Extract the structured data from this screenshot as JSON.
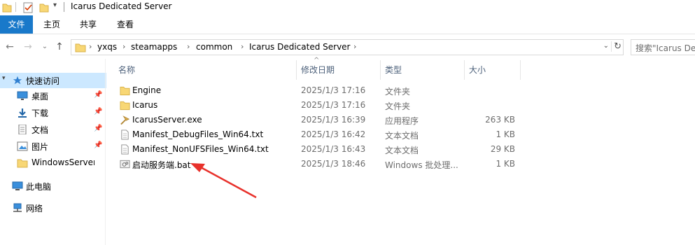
{
  "window": {
    "title": "Icarus Dedicated Server"
  },
  "ribbon": {
    "tabs": [
      "文件",
      "主页",
      "共享",
      "查看"
    ]
  },
  "address": {
    "crumbs": [
      "yxqs",
      "steamapps",
      "common",
      "Icarus Dedicated Server"
    ],
    "search_placeholder": "搜索\"Icarus Dedi"
  },
  "sidebar": {
    "quick_access": "快速访问",
    "items": [
      {
        "label": "桌面",
        "icon": "desktop-icon",
        "pinned": true
      },
      {
        "label": "下载",
        "icon": "download-icon",
        "pinned": true
      },
      {
        "label": "文档",
        "icon": "document-icon",
        "pinned": true
      },
      {
        "label": "图片",
        "icon": "picture-icon",
        "pinned": true
      },
      {
        "label": "WindowsServer",
        "icon": "folder-icon",
        "pinned": false
      }
    ],
    "this_pc": "此电脑",
    "network": "网络"
  },
  "columns": {
    "name": "名称",
    "date": "修改日期",
    "type": "类型",
    "size": "大小"
  },
  "files": [
    {
      "name": "Engine",
      "date": "2025/1/3 17:16",
      "type": "文件夹",
      "size": "",
      "icon": "folder-icon"
    },
    {
      "name": "Icarus",
      "date": "2025/1/3 17:16",
      "type": "文件夹",
      "size": "",
      "icon": "folder-icon"
    },
    {
      "name": "IcarusServer.exe",
      "date": "2025/1/3 16:39",
      "type": "应用程序",
      "size": "263 KB",
      "icon": "exe-icon"
    },
    {
      "name": "Manifest_DebugFiles_Win64.txt",
      "date": "2025/1/3 16:42",
      "type": "文本文档",
      "size": "1 KB",
      "icon": "text-file-icon"
    },
    {
      "name": "Manifest_NonUFSFiles_Win64.txt",
      "date": "2025/1/3 16:43",
      "type": "文本文档",
      "size": "29 KB",
      "icon": "text-file-icon"
    },
    {
      "name": "启动服务端.bat",
      "date": "2025/1/3 18:46",
      "type": "Windows 批处理...",
      "size": "1 KB",
      "icon": "batch-file-icon"
    }
  ],
  "colors": {
    "accent": "#1979ca",
    "selection": "#cce8ff",
    "folder": "#f8d775",
    "annotation_arrow": "#e8312b"
  }
}
